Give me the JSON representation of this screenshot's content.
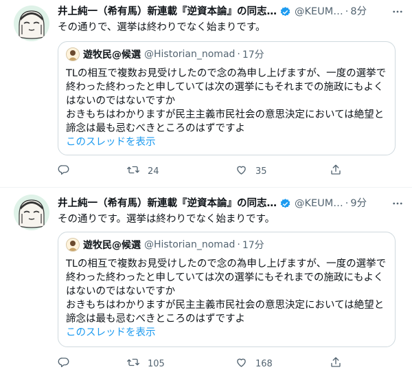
{
  "tweets": [
    {
      "author_name": "井上純一（希有馬）新連載『逆資本論』の同志…",
      "author_handle": "@KEUM…",
      "time": "8分",
      "text": "その通りで、選挙は終わりでなく始まりです。",
      "quote": {
        "name": "遊牧民@候選",
        "handle": "@Historian_nomad",
        "time": "17分",
        "lines": [
          "TLの相互で複数お見受けしたので念の為申し上げますが、一度の選挙で終わった終わったと申していては次の選挙にもそれまでの施政にもよくはないのではないですか",
          "おきもちはわかりますが民主主義市民社会の意思決定においては絶望と諦念は最も忌むべきところのはずですよ"
        ],
        "show_thread": "このスレッドを表示"
      },
      "retweets": "24",
      "likes": "35"
    },
    {
      "author_name": "井上純一（希有馬）新連載『逆資本論』の同志…",
      "author_handle": "@KEUM…",
      "time": "9分",
      "text": "その通りです。選挙は終わりでなく始まりです。",
      "quote": {
        "name": "遊牧民@候選",
        "handle": "@Historian_nomad",
        "time": "17分",
        "lines": [
          "TLの相互で複数お見受けしたので念の為申し上げますが、一度の選挙で終わった終わったと申していては次の選挙にもそれまでの施政にもよくはないのではないですか",
          "おきもちはわかりますが民主主義市民社会の意思決定においては絶望と諦念は最も忌むべきところのはずですよ"
        ],
        "show_thread": "このスレッドを表示"
      },
      "retweets": "105",
      "likes": "168"
    }
  ],
  "icons": {
    "verified": "verified-badge-icon",
    "more": "more-options-icon",
    "reply": "reply-icon",
    "retweet": "retweet-icon",
    "like": "heart-icon",
    "share": "share-icon"
  },
  "colors": {
    "text": "#0f1419",
    "secondary": "#536471",
    "link": "#1d9bf0",
    "border": "#cfd9de",
    "divider": "#eff3f4",
    "verified": "#1d9bf0"
  }
}
